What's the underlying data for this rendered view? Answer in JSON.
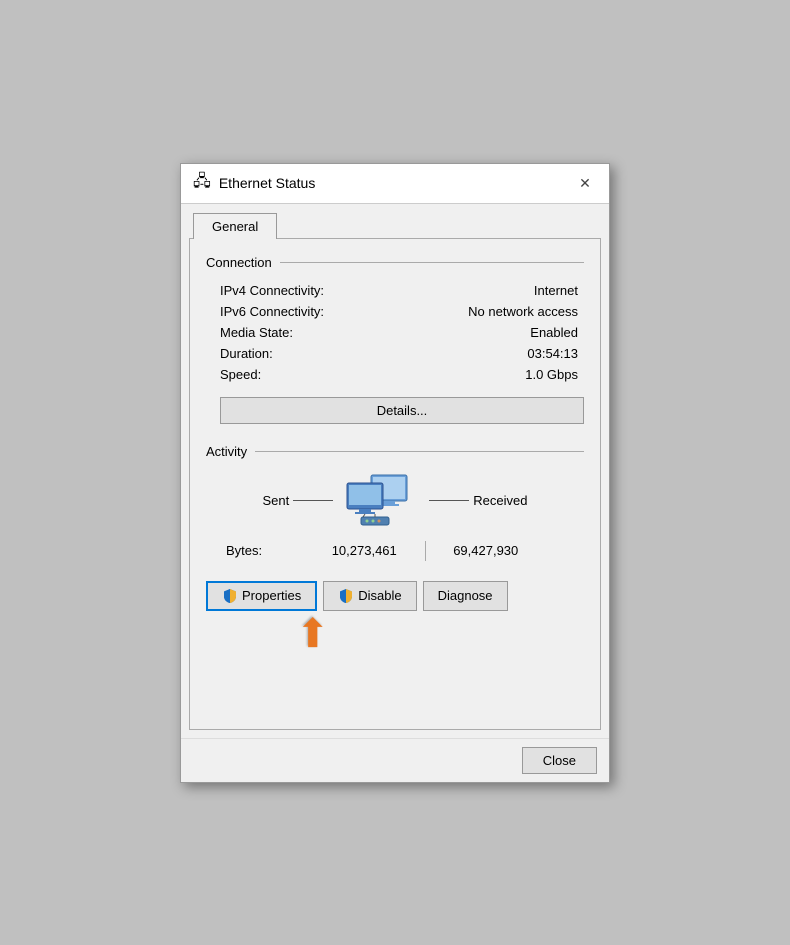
{
  "titleBar": {
    "icon": "🖧",
    "title": "Ethernet Status",
    "closeLabel": "✕"
  },
  "tabs": [
    {
      "id": "general",
      "label": "General",
      "active": true
    }
  ],
  "connection": {
    "sectionLabel": "Connection",
    "rows": [
      {
        "label": "IPv4 Connectivity:",
        "value": "Internet"
      },
      {
        "label": "IPv6 Connectivity:",
        "value": "No network access"
      },
      {
        "label": "Media State:",
        "value": "Enabled"
      },
      {
        "label": "Duration:",
        "value": "03:54:13"
      },
      {
        "label": "Speed:",
        "value": "1.0 Gbps"
      }
    ],
    "detailsButton": "Details..."
  },
  "activity": {
    "sectionLabel": "Activity",
    "sentLabel": "Sent",
    "receivedLabel": "Received",
    "bytesLabel": "Bytes:",
    "sentBytes": "10,273,461",
    "receivedBytes": "69,427,930"
  },
  "buttons": {
    "properties": "Properties",
    "disable": "Disable",
    "diagnose": "Diagnose"
  },
  "footer": {
    "closeLabel": "Close"
  }
}
